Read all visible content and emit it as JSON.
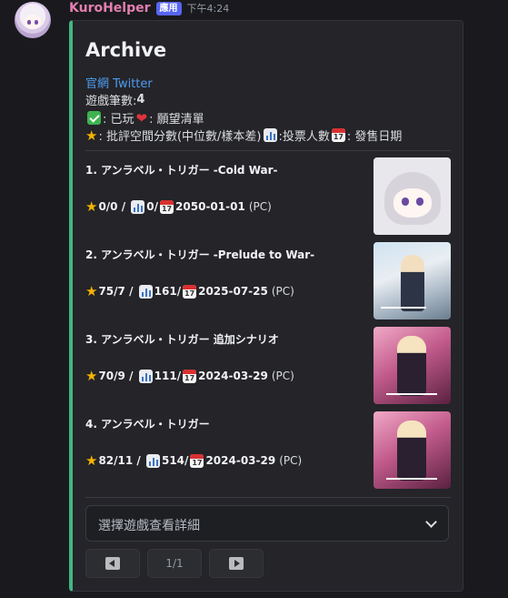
{
  "message": {
    "username": "KuroHelper",
    "badge": "應用",
    "timestamp": "下午4:24"
  },
  "embed": {
    "title": "Archive",
    "links": [
      "官網",
      "Twitter"
    ],
    "count_label": "遊戲筆數: ",
    "count_value": "4",
    "legend_played": ": 已玩",
    "legend_wish": ": 願望清單",
    "legend_score": ": 批評空間分數(中位數/樣本差)",
    "legend_votes": ":投票人數",
    "legend_date": ": 發售日期",
    "calendar_glyph": "17",
    "accent_color": "#43b581"
  },
  "games": [
    {
      "title": "1. アンラベル・トリガー -Cold War-",
      "score": "0/0",
      "votes": "0",
      "date": "2050-01-01",
      "platform": "(PC)",
      "thumb_style": "chibi"
    },
    {
      "title": "2. アンラベル・トリガー -Prelude to War-",
      "score": "75/7",
      "votes": "161",
      "date": "2025-07-25",
      "platform": "(PC)",
      "thumb_style": "cover-blue"
    },
    {
      "title": "3. アンラベル・トリガー 追加シナリオ",
      "score": "70/9",
      "votes": "111",
      "date": "2024-03-29",
      "platform": "(PC)",
      "thumb_style": "cover-pink"
    },
    {
      "title": "4. アンラベル・トリガー",
      "score": "82/11",
      "votes": "514",
      "date": "2024-03-29",
      "platform": "(PC)",
      "thumb_style": "cover-pink"
    }
  ],
  "select": {
    "placeholder": "選擇遊戲查看詳細"
  },
  "pagination": {
    "page": "1/1",
    "prev_icon": "left-arrow-icon",
    "next_icon": "right-arrow-icon"
  }
}
